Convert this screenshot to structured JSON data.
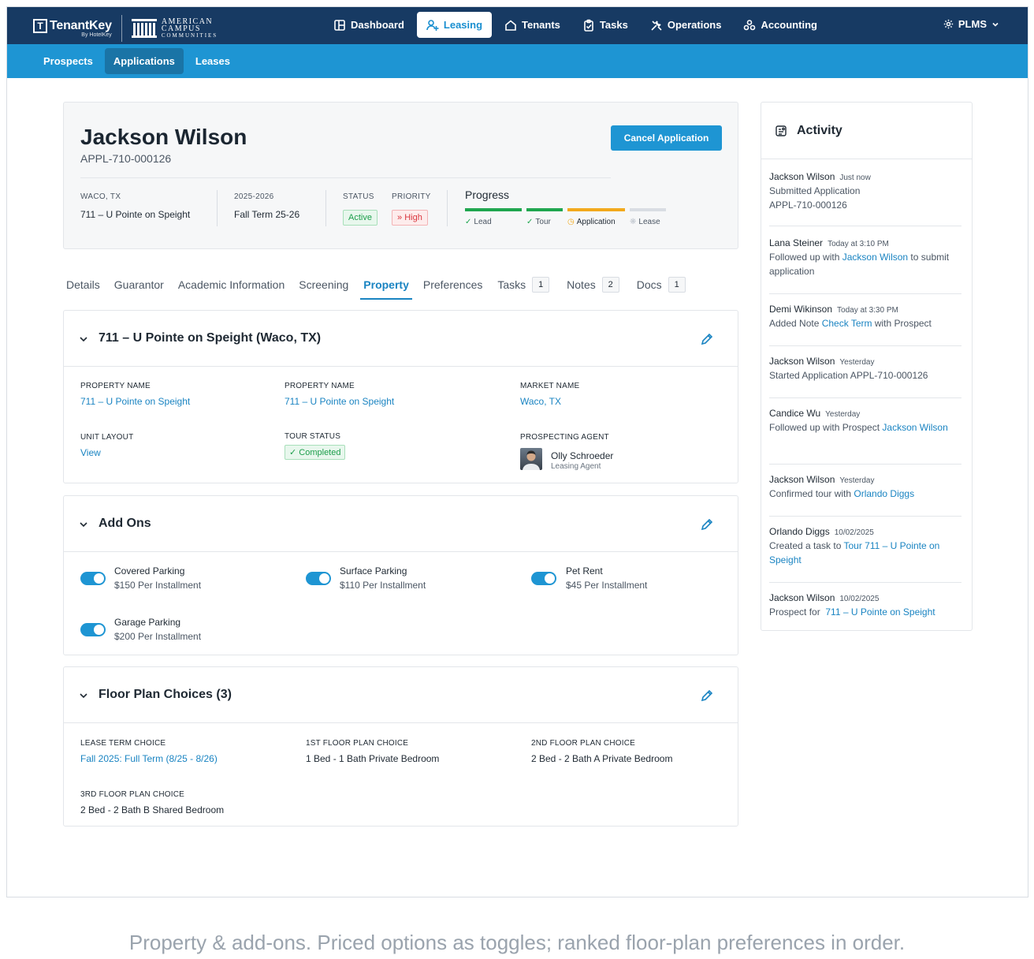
{
  "brand": {
    "tenantkey": "TenantKey",
    "by": "By HotelKey",
    "acc_line1": "American",
    "acc_line2": "Campus",
    "acc_line3": "Communities"
  },
  "nav": {
    "items": [
      {
        "label": "Dashboard",
        "icon": "dashboard-icon"
      },
      {
        "label": "Leasing",
        "icon": "leasing-icon"
      },
      {
        "label": "Tenants",
        "icon": "home-icon"
      },
      {
        "label": "Tasks",
        "icon": "clipboard-icon"
      },
      {
        "label": "Operations",
        "icon": "tools-icon"
      },
      {
        "label": "Accounting",
        "icon": "accounting-icon"
      }
    ],
    "active": "Leasing",
    "account": "PLMS"
  },
  "subnav": {
    "items": [
      "Prospects",
      "Applications",
      "Leases"
    ],
    "active": "Applications"
  },
  "header": {
    "name": "Jackson Wilson",
    "app_id": "APPL-710-000126",
    "cancel_label": "Cancel Application",
    "location_label": "WACO, TX",
    "location_value": "711 – U Pointe on Speight",
    "term_label": "2025-2026",
    "term_value": "Fall Term 25-26",
    "status_label": "STATUS",
    "status_value": "Active",
    "priority_label": "PRIORITY",
    "priority_value": "High",
    "progress_title": "Progress",
    "progress_steps": [
      {
        "label": "Lead",
        "state": "complete",
        "color": "#1fa64f"
      },
      {
        "label": "Tour",
        "state": "complete",
        "color": "#1fa64f"
      },
      {
        "label": "Application",
        "state": "in-progress",
        "color": "#f2a91c"
      },
      {
        "label": "Lease",
        "state": "pending",
        "color": "#d9dde3"
      }
    ]
  },
  "tabs": [
    {
      "label": "Details"
    },
    {
      "label": "Guarantor"
    },
    {
      "label": "Academic Information"
    },
    {
      "label": "Screening"
    },
    {
      "label": "Property",
      "active": true
    },
    {
      "label": "Preferences"
    },
    {
      "label": "Tasks",
      "count": "1"
    },
    {
      "label": "Notes",
      "count": "2"
    },
    {
      "label": "Docs",
      "count": "1"
    }
  ],
  "property": {
    "title": "711 – U Pointe on Speight (Waco, TX)",
    "fields": {
      "prop_name_1_label": "PROPERTY NAME",
      "prop_name_1_value": "711 – U Pointe on Speight",
      "prop_name_2_label": "PROPERTY NAME",
      "prop_name_2_value": "711 – U Pointe on Speight",
      "market_label": "MARKET NAME",
      "market_value": "Waco, TX",
      "unit_layout_label": "UNIT LAYOUT",
      "unit_layout_value": "View",
      "tour_status_label": "TOUR STATUS",
      "tour_status_value": "Completed",
      "agent_label": "PROSPECTING AGENT",
      "agent_name": "Olly Schroeder",
      "agent_role": "Leasing Agent"
    }
  },
  "addons": {
    "title": "Add Ons",
    "items": [
      {
        "name": "Covered Parking",
        "price": "$150 Per Installment",
        "enabled": true
      },
      {
        "name": "Surface Parking",
        "price": "$110 Per Installment",
        "enabled": true
      },
      {
        "name": "Pet Rent",
        "price": "$45 Per Installment",
        "enabled": true
      },
      {
        "name": "Garage Parking",
        "price": "$200 Per Installment",
        "enabled": true
      }
    ]
  },
  "floorplans": {
    "title": "Floor Plan Choices (3)",
    "lease_term_label": "LEASE TERM CHOICE",
    "lease_term_value": "Fall 2025: Full Term (8/25 - 8/26)",
    "first_label": "1ST FLOOR PLAN CHOICE",
    "first_value": "1 Bed - 1 Bath Private Bedroom",
    "second_label": "2ND FLOOR PLAN CHOICE",
    "second_value": "2 Bed - 2 Bath A Private Bedroom",
    "third_label": "3RD FLOOR PLAN CHOICE",
    "third_value": "2 Bed - 2 Bath B Shared Bedroom"
  },
  "activity": {
    "title": "Activity",
    "items": [
      {
        "who": "Jackson Wilson",
        "when": "Just now",
        "text": "Submitted Application",
        "link": "APPL-710-000126"
      },
      {
        "who": "Lana Steiner",
        "when": "Today at 3:10 PM",
        "text_before": "Followed up with ",
        "link": "Jackson Wilson",
        "text_after": " to submit application"
      },
      {
        "who": "Demi Wikinson",
        "when": "Today at 3:30 PM",
        "text_before": "Added Note ",
        "link": "Check Term",
        "text_after": " with Prospect"
      },
      {
        "who": "Jackson Wilson",
        "when": "Yesterday",
        "text": "Started Application APPL-710-000126"
      },
      {
        "who": "Candice Wu",
        "when": "Yesterday",
        "text_before": "Followed up with Prospect ",
        "link": "Jackson Wilson"
      },
      {
        "who": "Jackson Wilson",
        "when": "Yesterday",
        "text_before": "Confirmed tour with ",
        "link": "Orlando Diggs"
      },
      {
        "who": "Orlando Diggs",
        "when": "10/02/2025",
        "text_before": "Created a task to ",
        "link": "Tour 711 – U Pointe on Speight"
      },
      {
        "who": "Jackson Wilson",
        "when": "10/02/2025",
        "text_before": "Prospect for  ",
        "link": "711 – U Pointe on Speight"
      }
    ]
  },
  "caption": "Property & add-ons. Priced options as toggles; ranked floor-plan preferences in order."
}
